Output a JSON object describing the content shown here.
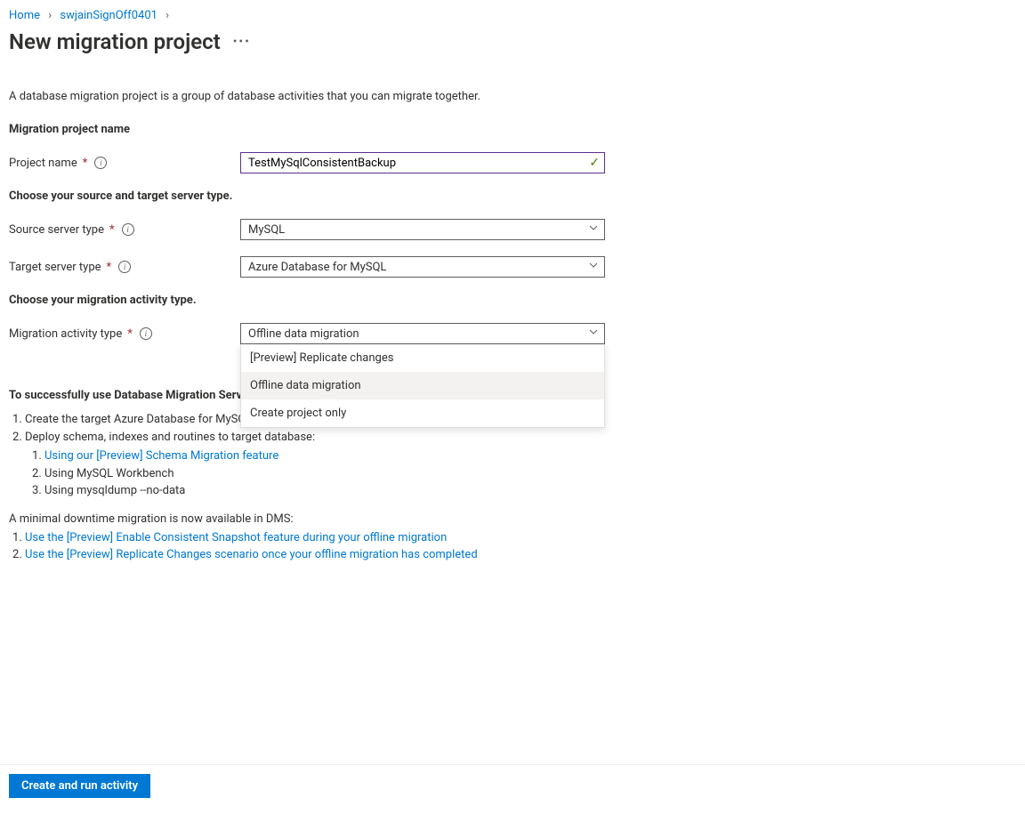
{
  "breadcrumb": {
    "home": "Home",
    "item": "swjainSignOff0401"
  },
  "title": "New migration project",
  "description": "A database migration project is a group of database activities that you can migrate together.",
  "sections": {
    "projectNameHead": "Migration project name",
    "sourceTargetHead": "Choose your source and target server type.",
    "activityHead": "Choose your migration activity type."
  },
  "fields": {
    "projectName": {
      "label": "Project name",
      "value": "TestMySqlConsistentBackup"
    },
    "sourceType": {
      "label": "Source server type",
      "value": "MySQL"
    },
    "targetType": {
      "label": "Target server type",
      "value": "Azure Database for MySQL"
    },
    "activityType": {
      "label": "Migration activity type",
      "value": "Offline data migration"
    }
  },
  "activityOptions": [
    "[Preview] Replicate changes",
    "Offline data migration",
    "Create project only"
  ],
  "instructions": {
    "head": "To successfully use Database Migration Service, you need to:",
    "steps": {
      "s1": "Create the target Azure Database for MySQL.",
      "s2": "Deploy schema, indexes and routines to target database:",
      "s2a": "Using our [Preview] Schema Migration feature",
      "s2b": "Using MySQL Workbench",
      "s2c": "Using mysqldump --no-data"
    },
    "downtimeHead": "A minimal downtime migration is now available in DMS:",
    "d1": "Use the [Preview] Enable Consistent Snapshot feature during your offline migration",
    "d2": "Use the [Preview] Replicate Changes scenario once your offline migration has completed"
  },
  "footer": {
    "button": "Create and run activity"
  }
}
